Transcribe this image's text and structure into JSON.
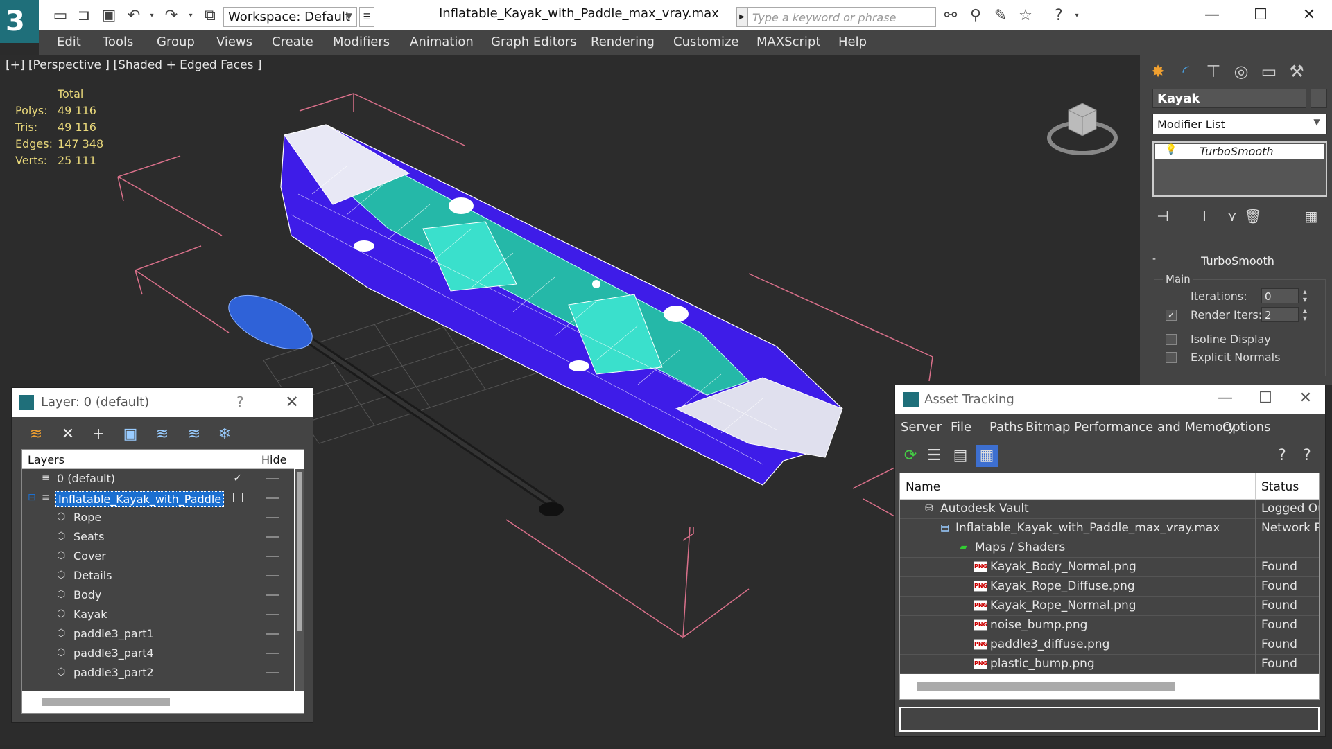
{
  "titlebar": {
    "workspace": "Workspace: Default",
    "window_title": "Inflatable_Kayak_with_Paddle_max_vray.max",
    "search_placeholder": "Type a keyword or phrase",
    "minimize": "—",
    "maximize": "☐",
    "close": "✕"
  },
  "menubar": {
    "items": [
      "Edit",
      "Tools",
      "Group",
      "Views",
      "Create",
      "Modifiers",
      "Animation",
      "Graph Editors",
      "Rendering",
      "Customize",
      "MAXScript",
      "Help"
    ]
  },
  "viewport": {
    "label": "[+] [Perspective ] [Shaded + Edged Faces ]",
    "stats": {
      "header": "Total",
      "rows": [
        {
          "label": "Polys:",
          "value": "49 116"
        },
        {
          "label": "Tris:",
          "value": "49 116"
        },
        {
          "label": "Edges:",
          "value": "147 348"
        },
        {
          "label": "Verts:",
          "value": "25 111"
        }
      ]
    }
  },
  "command_panel": {
    "object_name": "Kayak",
    "modifier_list": "Modifier List",
    "stack_item": "TurboSmooth",
    "rollout_title": "TurboSmooth",
    "group_main": "Main",
    "iterations_label": "Iterations:",
    "iterations_value": "0",
    "render_iters_label": "Render Iters:",
    "render_iters_value": "2",
    "render_iters_checked": true,
    "isoline_label": "Isoline Display",
    "explicit_normals_label": "Explicit Normals"
  },
  "layer_dialog": {
    "title": "Layer: 0 (default)",
    "help": "?",
    "close": "✕",
    "col_layers": "Layers",
    "col_hide": "Hide",
    "rows": [
      {
        "label": "0 (default)",
        "indent": 0,
        "type": "layer",
        "current": true
      },
      {
        "label": "Inflatable_Kayak_with_Paddle",
        "indent": 0,
        "type": "layer",
        "selected": true
      },
      {
        "label": "Rope",
        "indent": 1,
        "type": "object"
      },
      {
        "label": "Seats",
        "indent": 1,
        "type": "object"
      },
      {
        "label": "Cover",
        "indent": 1,
        "type": "object"
      },
      {
        "label": "Details",
        "indent": 1,
        "type": "object"
      },
      {
        "label": "Body",
        "indent": 1,
        "type": "object"
      },
      {
        "label": "Kayak",
        "indent": 1,
        "type": "object"
      },
      {
        "label": "paddle3_part1",
        "indent": 1,
        "type": "object"
      },
      {
        "label": "paddle3_part4",
        "indent": 1,
        "type": "object"
      },
      {
        "label": "paddle3_part2",
        "indent": 1,
        "type": "object"
      }
    ]
  },
  "asset_dialog": {
    "title": "Asset Tracking",
    "menu": [
      "Server",
      "File",
      "Paths",
      "Bitmap Performance and Memory",
      "Options"
    ],
    "col_name": "Name",
    "col_status": "Status",
    "rows": [
      {
        "name": "Autodesk Vault",
        "status": "Logged Ou",
        "icon": "vault-icon",
        "level": 1
      },
      {
        "name": "Inflatable_Kayak_with_Paddle_max_vray.max",
        "status": "Network Pa",
        "icon": "max-file-icon",
        "level": 2
      },
      {
        "name": "Maps / Shaders",
        "status": "",
        "icon": "maps-icon",
        "level": 3
      },
      {
        "name": "Kayak_Body_Normal.png",
        "status": "Found",
        "icon": "png-icon",
        "level": 4
      },
      {
        "name": "Kayak_Rope_Diffuse.png",
        "status": "Found",
        "icon": "png-icon",
        "level": 4
      },
      {
        "name": "Kayak_Rope_Normal.png",
        "status": "Found",
        "icon": "png-icon",
        "level": 4
      },
      {
        "name": "noise_bump.png",
        "status": "Found",
        "icon": "png-icon",
        "level": 4
      },
      {
        "name": "paddle3_diffuse.png",
        "status": "Found",
        "icon": "png-icon",
        "level": 4
      },
      {
        "name": "plastic_bump.png",
        "status": "Found",
        "icon": "png-icon",
        "level": 4
      }
    ],
    "png_badge": "PNG"
  }
}
